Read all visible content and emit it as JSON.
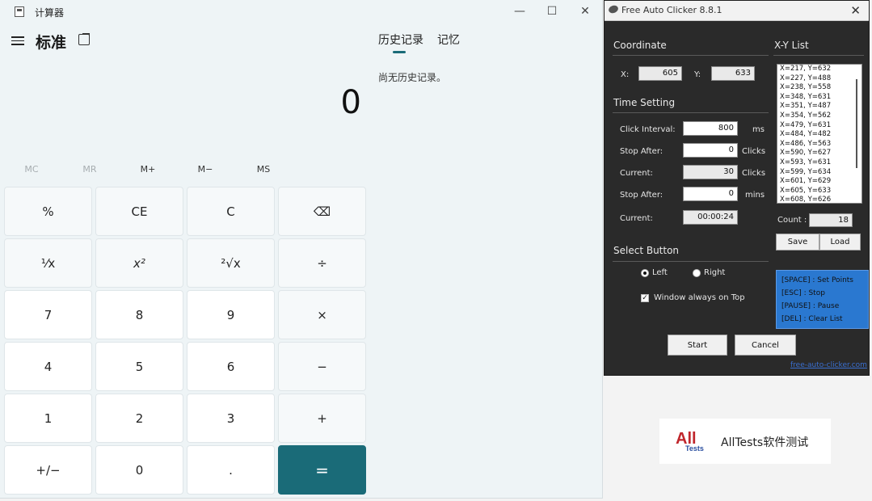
{
  "calculator": {
    "window_title": "计算器",
    "mode_title": "标准",
    "display_value": "0",
    "tabs": [
      {
        "label": "历史记录"
      },
      {
        "label": "记忆"
      }
    ],
    "history_empty": "尚无历史记录。",
    "memory_buttons": [
      {
        "label": "MC",
        "enabled": false
      },
      {
        "label": "MR",
        "enabled": false
      },
      {
        "label": "M+",
        "enabled": true
      },
      {
        "label": "M−",
        "enabled": true
      },
      {
        "label": "MS",
        "enabled": true
      }
    ],
    "keys": [
      [
        "%",
        "CE",
        "C",
        "⌫"
      ],
      [
        "¹⁄x",
        "x²",
        "²√x",
        "÷"
      ],
      [
        "7",
        "8",
        "9",
        "×"
      ],
      [
        "4",
        "5",
        "6",
        "−"
      ],
      [
        "1",
        "2",
        "3",
        "+"
      ],
      [
        "+/−",
        "0",
        ".",
        "="
      ]
    ],
    "accent_color": "#1a6b78"
  },
  "auto_clicker": {
    "window_title": "Free Auto Clicker 8.8.1",
    "coordinate": {
      "section": "Coordinate",
      "x_label": "X:",
      "x_value": "605",
      "y_label": "Y:",
      "y_value": "633"
    },
    "time_setting": {
      "section": "Time Setting",
      "rows": [
        {
          "label": "Click Interval:",
          "value": "800",
          "unit": "ms"
        },
        {
          "label": "Stop After:",
          "value": "0",
          "unit": "Clicks"
        },
        {
          "label": "Current:",
          "value": "30",
          "unit": "Clicks"
        },
        {
          "label": "Stop After:",
          "value": "0",
          "unit": "mins"
        },
        {
          "label": "Current:",
          "value": "00:00:24",
          "unit": ""
        }
      ]
    },
    "select_button": {
      "section": "Select Button",
      "left": "Left",
      "right": "Right",
      "selected": "left",
      "always_on_top": "Window always on Top",
      "always_on_top_checked": true
    },
    "xy_list": {
      "section": "X-Y List",
      "items": [
        "X=217, Y=632",
        "X=227, Y=488",
        "X=238, Y=558",
        "X=348, Y=631",
        "X=351, Y=487",
        "X=354, Y=562",
        "X=479, Y=631",
        "X=484, Y=482",
        "X=486, Y=563",
        "X=590, Y=627",
        "X=593, Y=631",
        "X=599, Y=634",
        "X=601, Y=629",
        "X=605, Y=633",
        "X=608, Y=626"
      ],
      "count_label": "Count :",
      "count_value": "18",
      "save": "Save",
      "load": "Load"
    },
    "hotkeys": [
      "[SPACE] : Set Points",
      "[ESC] : Stop",
      "[PAUSE] : Pause",
      "[DEL] : Clear List"
    ],
    "start": "Start",
    "cancel": "Cancel",
    "link": "free-auto-clicker.com"
  },
  "banner": {
    "logo_all": "All",
    "logo_tests": "Tests",
    "text": "AllTests软件测试"
  }
}
